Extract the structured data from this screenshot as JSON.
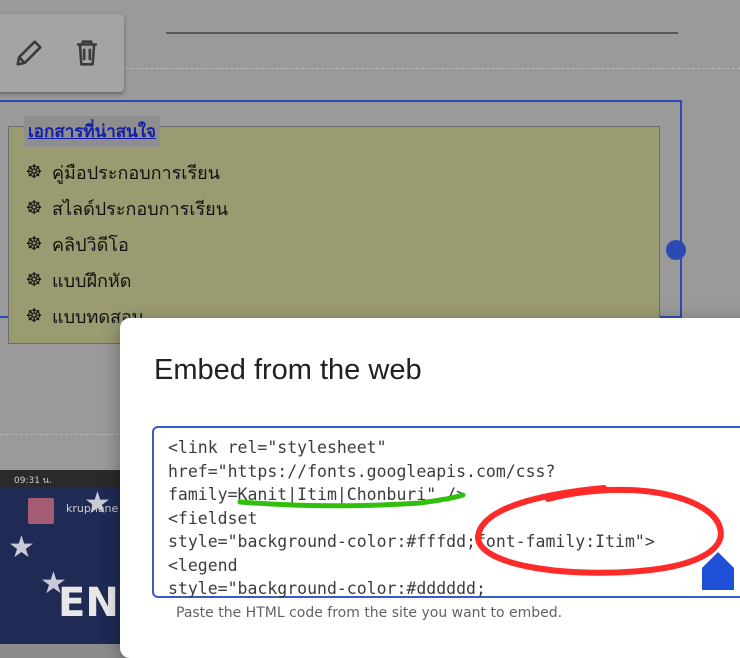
{
  "colors": {
    "legend_text": "#1420a8",
    "selection_border": "#2b4bb3",
    "code_border": "#3a5bbf",
    "annotation_green": "#2fbf0c",
    "annotation_red": "#ff2a2a"
  },
  "toolbar": {
    "edit_icon": "pencil-icon",
    "delete_icon": "trash-icon"
  },
  "documents": {
    "legend": "เอกสารที่น่าสนใจ",
    "bullet_icon": "dharma-wheel-icon",
    "bullet": "☸",
    "items": [
      {
        "label": "คู่มือประกอบการเรียน"
      },
      {
        "label": "สไลด์ประกอบการเรียน"
      },
      {
        "label": "คลิปวิดีโอ"
      },
      {
        "label": "แบบฝึกหัด"
      },
      {
        "label": "แบบทดสอบ"
      }
    ]
  },
  "thumbnail": {
    "time": "09:31 น.",
    "channel": "kruphane",
    "big_text": "EN"
  },
  "dialog": {
    "title": "Embed from the web",
    "code_lines": [
      "<link rel=\"stylesheet\"",
      "href=\"https://fonts.googleapis.com/css?",
      "family=Kanit|Itim|Chonburi\" />",
      "<fieldset",
      "style=\"background-color:#fffdd;font-family:Itim\">",
      "<legend",
      "style=\"background-color:#dddddd;"
    ],
    "hint": "Paste the HTML code from the site you want to embed."
  }
}
